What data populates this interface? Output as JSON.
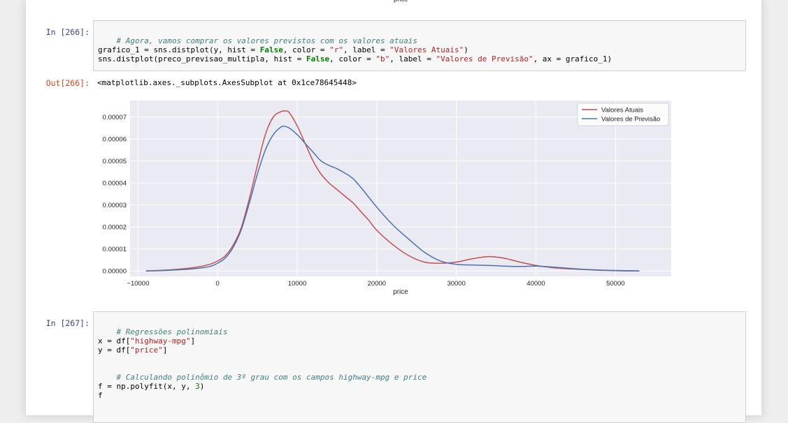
{
  "prev_output": {
    "xlabel": "price"
  },
  "cell_266": {
    "prompt": "In [266]:",
    "line1": {
      "comment": "# Agora, vamos comprar os valores previstos com os valores atuais"
    },
    "line2": {
      "p1": "grafico_1 = sns.distplot(y, hist = ",
      "kw1": "False",
      "p2": ", color = ",
      "s1": "\"r\"",
      "p3": ", label = ",
      "s2": "\"Valores Atuais\"",
      "p4": ")"
    },
    "line3": {
      "p1": "sns.distplot(preco_previsao_multipla, hist = ",
      "kw1": "False",
      "p2": ", color = ",
      "s1": "\"b\"",
      "p3": ", label = ",
      "s2": "\"Valores de Previsão\"",
      "p4": ", ax = grafico_1)"
    }
  },
  "out_266": {
    "prompt": "Out[266]:",
    "text": "<matplotlib.axes._subplots.AxesSubplot at 0x1ce78645448>"
  },
  "chart_data": {
    "type": "line",
    "xlabel": "price",
    "ylabel": "",
    "xlim": [
      -11000,
      57000
    ],
    "ylim": [
      -2.5e-06,
      7.75e-05
    ],
    "xticks": [
      -10000,
      0,
      10000,
      20000,
      30000,
      40000,
      50000
    ],
    "xtick_labels": [
      "−10000",
      "0",
      "10000",
      "20000",
      "30000",
      "40000",
      "50000"
    ],
    "yticks": [
      0,
      1e-05,
      2e-05,
      3e-05,
      4e-05,
      5e-05,
      6e-05,
      7e-05
    ],
    "ytick_labels": [
      "0.00000",
      "0.00001",
      "0.00002",
      "0.00003",
      "0.00004",
      "0.00005",
      "0.00006",
      "0.00007"
    ],
    "grid": true,
    "legend_position": "top-right",
    "background": "#eaeaf2",
    "series": [
      {
        "name": "Valores Atuais",
        "color": "#c44e52",
        "x": [
          -9000,
          -6000,
          -3000,
          -1000,
          0,
          1000,
          2000,
          3000,
          4000,
          5000,
          6000,
          7000,
          8000,
          8500,
          9000,
          10000,
          11000,
          12000,
          13000,
          14000,
          15000,
          16000,
          17000,
          18000,
          19000,
          20000,
          22000,
          24000,
          26000,
          28000,
          30000,
          32000,
          34000,
          36000,
          38000,
          40000,
          42000,
          44000,
          46000,
          48000,
          50000,
          53000
        ],
        "values": [
          0.0,
          5e-07,
          1.5e-06,
          3e-06,
          4.5e-06,
          7e-06,
          1.2e-05,
          2e-05,
          3.3e-05,
          4.8e-05,
          6.2e-05,
          7e-05,
          7.25e-05,
          7.27e-05,
          7.2e-05,
          6.6e-05,
          5.8e-05,
          5e-05,
          4.4e-05,
          4e-05,
          3.7e-05,
          3.4e-05,
          3.1e-05,
          2.7e-05,
          2.3e-05,
          1.85e-05,
          1.2e-05,
          7e-06,
          4e-06,
          3.5e-06,
          4e-06,
          5.5e-06,
          6.5e-06,
          5.8e-06,
          4e-06,
          2.5e-06,
          1.5e-06,
          1e-06,
          6e-07,
          3e-07,
          1e-07,
          0.0
        ]
      },
      {
        "name": "Valores de Previsão",
        "color": "#4c72b0",
        "x": [
          -9000,
          -6000,
          -3000,
          -1000,
          0,
          1000,
          2000,
          3000,
          4000,
          5000,
          6000,
          7000,
          8000,
          8500,
          9000,
          10000,
          11000,
          12000,
          13000,
          14000,
          15000,
          16000,
          17000,
          18000,
          19000,
          20000,
          22000,
          24000,
          26000,
          28000,
          30000,
          32000,
          34000,
          36000,
          38000,
          40000,
          42000,
          44000,
          46000,
          48000,
          50000,
          53000
        ],
        "values": [
          0.0,
          3e-07,
          1e-06,
          2e-06,
          3.5e-06,
          6e-06,
          1.1e-05,
          1.9e-05,
          3.1e-05,
          4.4e-05,
          5.5e-05,
          6.2e-05,
          6.55e-05,
          6.57e-05,
          6.5e-05,
          6.2e-05,
          5.8e-05,
          5.4e-05,
          5e-05,
          4.8e-05,
          4.65e-05,
          4.45e-05,
          4.2e-05,
          3.8e-05,
          3.35e-05,
          2.9e-05,
          2.1e-05,
          1.45e-05,
          8.5e-06,
          4.5e-06,
          3e-06,
          2.7e-06,
          2.5e-06,
          2.2e-06,
          2e-06,
          2.2e-06,
          1.8e-06,
          1.2e-06,
          7e-07,
          4e-07,
          2e-07,
          0.0
        ]
      }
    ]
  },
  "cell_267": {
    "prompt": "In [267]:",
    "line1": {
      "comment": "# Regressões polinomiais"
    },
    "line2": {
      "p1": "x = df[",
      "s1": "\"highway-mpg\"",
      "p2": "]"
    },
    "line3": {
      "p1": "y = df[",
      "s1": "\"price\"",
      "p2": "]"
    },
    "line4": {
      "comment": "# Calculando polinômio de 3º grau com os campos highway-mpg e price"
    },
    "line5": {
      "p1": "f = np.polyfit(x, y, ",
      "n1": "3",
      "p2": ")"
    },
    "line6": {
      "p1": "f"
    }
  }
}
